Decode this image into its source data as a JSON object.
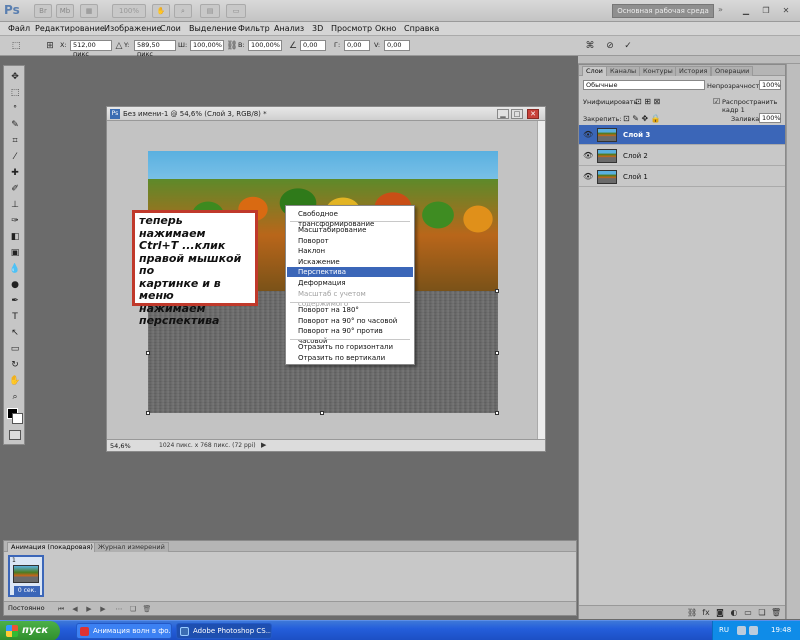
{
  "app": {
    "logo": "Ps",
    "zoom_select": "100%",
    "workspace": "Основная рабочая среда",
    "workspace_arrow": "»"
  },
  "menu": [
    "Файл",
    "Редактирование",
    "Изображение",
    "Слои",
    "Выделение",
    "Фильтр",
    "Анализ",
    "3D",
    "Просмотр",
    "Окно",
    "Справка"
  ],
  "options": {
    "x_label": "X:",
    "x_value": "512,00 пикс",
    "y_label": "Y:",
    "y_value": "589,50 пикс",
    "w_label": "Ш:",
    "w_value": "100,00%",
    "h_label": "В:",
    "h_value": "100,00%",
    "angle_value": "0,00",
    "hskew_label": "Г:",
    "hskew_value": "0,00",
    "vskew_label": "V:",
    "vskew_value": "0,00"
  },
  "document": {
    "title": "Без имени-1 @ 54,6% (Слой 3, RGB/8) *",
    "zoom": "54,6%",
    "info": "1024 пикс. x 768 пикс. (72 ppi)"
  },
  "annotation": "теперь нажимаем\nCtrl+T ...клик\nправой мышкой по\nкартинке и в меню\nнажимаем\nперспектива",
  "context_menu": {
    "items": [
      {
        "label": "Свободное трансформирование",
        "state": "normal"
      },
      {
        "label": "Масштабирование",
        "state": "normal"
      },
      {
        "label": "Поворот",
        "state": "normal"
      },
      {
        "label": "Наклон",
        "state": "normal"
      },
      {
        "label": "Искажение",
        "state": "normal"
      },
      {
        "label": "Перспектива",
        "state": "active"
      },
      {
        "label": "Деформация",
        "state": "normal"
      },
      {
        "label": "Масштаб с учетом содержимого",
        "state": "disabled"
      },
      {
        "label": "Поворот на 180°",
        "state": "normal"
      },
      {
        "label": "Поворот на 90° по часовой",
        "state": "normal"
      },
      {
        "label": "Поворот на 90° против часовой",
        "state": "normal"
      },
      {
        "label": "Отразить по горизонтали",
        "state": "normal"
      },
      {
        "label": "Отразить по вертикали",
        "state": "normal"
      }
    ]
  },
  "layers_panel": {
    "tabs": [
      "Слои",
      "Каналы",
      "Контуры",
      "История",
      "Операции"
    ],
    "blend_mode": "Обычные",
    "opacity_label": "Непрозрачность:",
    "opacity": "100%",
    "unify_label": "Унифицировать:",
    "propagate_label": "Распространить кадр 1",
    "lock_label": "Закрепить:",
    "fill_label": "Заливка:",
    "fill": "100%",
    "layers": [
      {
        "name": "Слой 3",
        "active": true
      },
      {
        "name": "Слой 2",
        "active": false
      },
      {
        "name": "Слой 1",
        "active": false
      }
    ]
  },
  "animation_panel": {
    "tabs": [
      "Анимация (покадровая)",
      "Журнал измерений"
    ],
    "frame_number": "1",
    "frame_time": "0 сек.",
    "loop": "Постоянно"
  },
  "taskbar": {
    "start": "пуск",
    "tasks": [
      {
        "label": "Анимация волн в фо...",
        "active": false
      },
      {
        "label": "Adobe Photoshop CS...",
        "active": true
      }
    ],
    "lang": "RU",
    "clock": "19:48"
  },
  "colors": {
    "accent": "#3b66b8",
    "annotation_border": "#c0392b",
    "taskbar": "#245edb"
  }
}
